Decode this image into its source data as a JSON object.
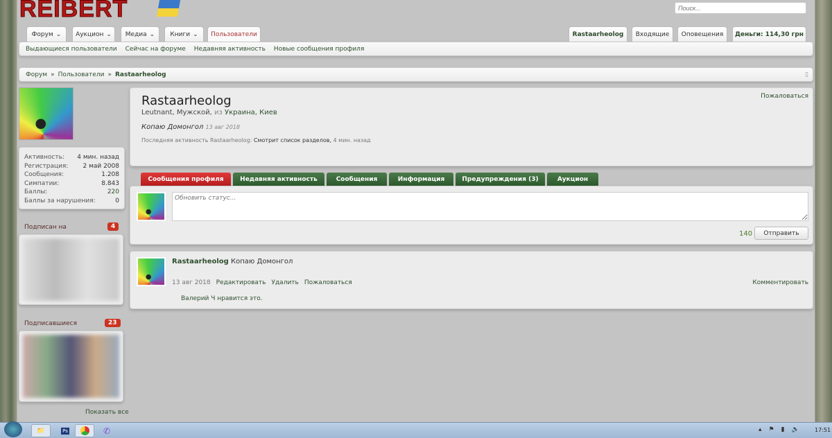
{
  "header": {
    "logo": "REIBERT",
    "search_placeholder": "Поиск..."
  },
  "nav": {
    "tabs": [
      {
        "label": "Форум"
      },
      {
        "label": "Аукцион"
      },
      {
        "label": "Медиа"
      },
      {
        "label": "Книги"
      },
      {
        "label": "Пользователи"
      }
    ],
    "right": {
      "user": "Rastaarheolog",
      "inbox": "Входящие",
      "alerts": "Оповещения",
      "money": "Деньги: 114,30 грн"
    },
    "subnav": [
      "Выдающиеся пользователи",
      "Сейчас на форуме",
      "Недавняя активность",
      "Новые сообщения профиля"
    ]
  },
  "breadcrumb": [
    "Форум",
    "Пользователи",
    "Rastaarheolog"
  ],
  "sidebar": {
    "stats": [
      {
        "k": "Активность:",
        "v": "4 мин. назад"
      },
      {
        "k": "Регистрация:",
        "v": "2 май 2008"
      },
      {
        "k": "Сообщения:",
        "v": "1.208"
      },
      {
        "k": "Симпатии:",
        "v": "8.843"
      },
      {
        "k": "Баллы:",
        "v": "220"
      },
      {
        "k": "Баллы за нарушения:",
        "v": "0"
      }
    ],
    "following": {
      "label": "Подписан на",
      "count": "4"
    },
    "followers": {
      "label": "Подписавшиеся",
      "count": "23"
    },
    "show_all": "Показать все"
  },
  "profile": {
    "name": "Rastaarheolog",
    "rank": "Leutnant",
    "gender": "Мужской",
    "from": "из",
    "location": "Украина, Киев",
    "status": "Копаю Домонгол",
    "status_date": "13 авг 2018",
    "last_label": "Последняя активность Rastaarheolog:",
    "last_action": "Смотрит список разделов,",
    "last_time": "4 мин. назад",
    "report": "Пожаловаться"
  },
  "tabs": [
    "Сообщения профиля",
    "Недавняя активность",
    "Сообщения",
    "Информация",
    "Предупреждения (3)",
    "Аукцион"
  ],
  "composer": {
    "placeholder": "Обновить статус...",
    "counter": "140",
    "submit": "Отправить"
  },
  "post": {
    "author": "Rastaarheolog",
    "text": "Копаю Домонгол",
    "date": "13 авг 2018",
    "edit": "Редактировать",
    "delete": "Удалить",
    "report": "Пожаловаться",
    "comment": "Комментировать",
    "likes": "Валерий Ч нравится это."
  },
  "taskbar": {
    "time": "17:51"
  }
}
